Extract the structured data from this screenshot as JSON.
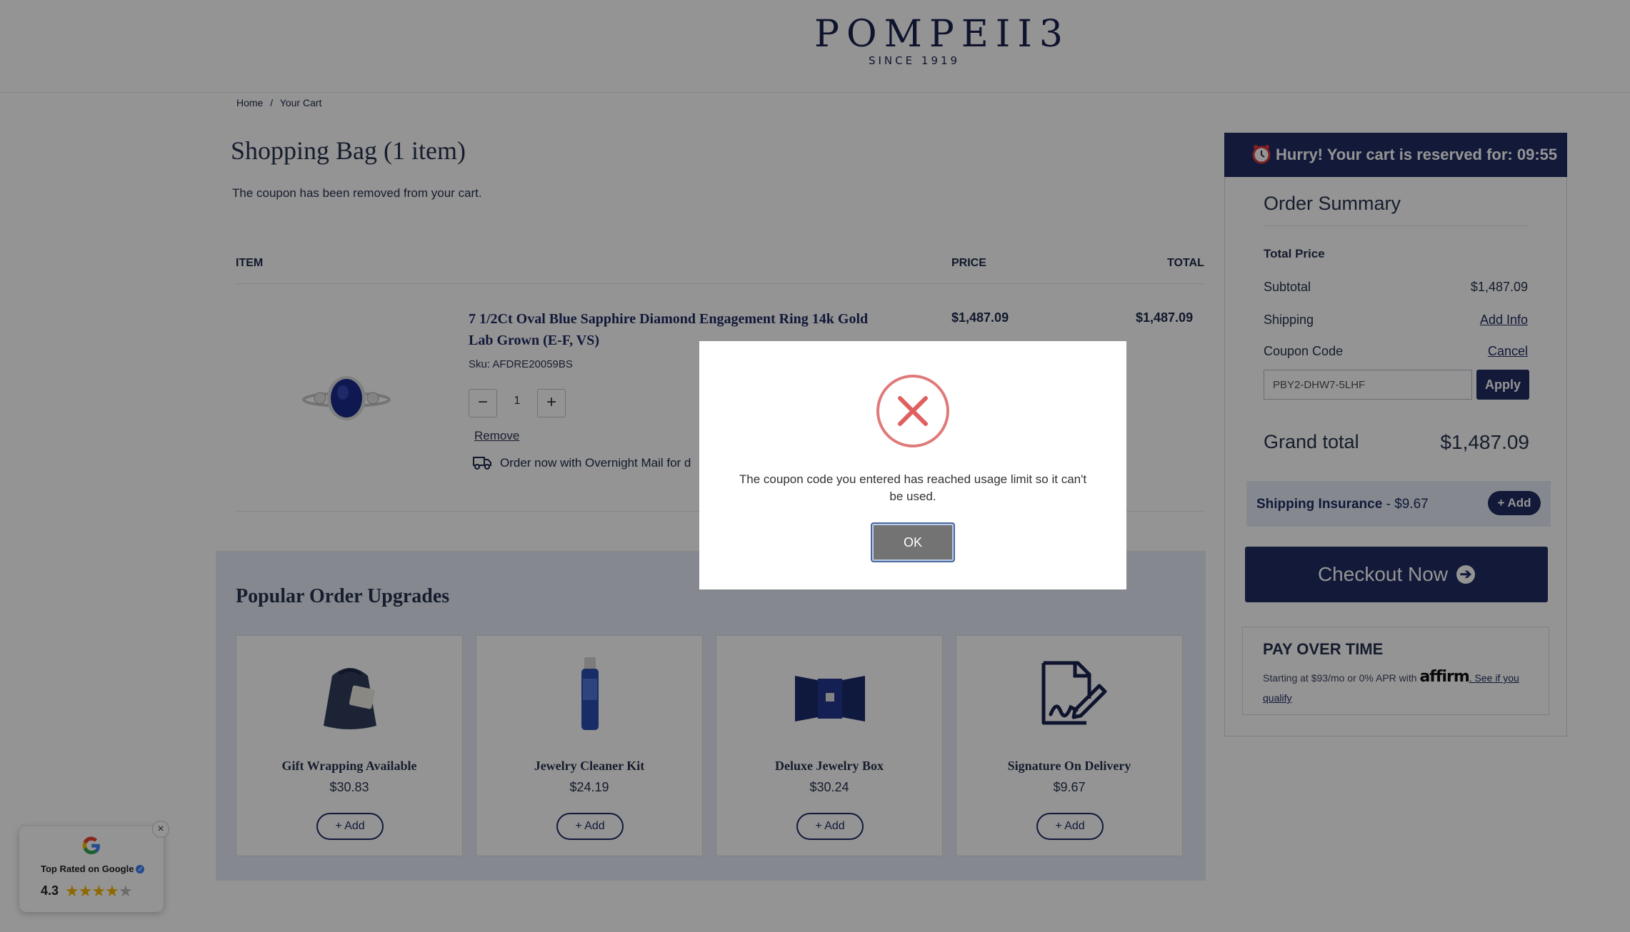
{
  "header": {
    "logo_main": "POMPEII3",
    "logo_sub": "SINCE 1919"
  },
  "breadcrumb": {
    "home": "Home",
    "separator": "/",
    "current": "Your Cart"
  },
  "cart": {
    "title": "Shopping Bag (1 item)",
    "notice": "The coupon has been removed from your cart.",
    "columns": {
      "item": "ITEM",
      "price": "PRICE",
      "total": "TOTAL"
    },
    "item": {
      "name": "7 1/2Ct Oval Blue Sapphire Diamond Engagement Ring 14k Gold Lab Grown (E-F, VS)",
      "sku": "Sku: AFDRE20059BS",
      "quantity": "1",
      "minus": "−",
      "plus": "+",
      "remove": "Remove",
      "shipping_note": "Order now with Overnight Mail for d",
      "price": "$1,487.09",
      "total": "$1,487.09"
    }
  },
  "upgrades": {
    "title": "Popular Order Upgrades",
    "add_label": "+ Add",
    "items": [
      {
        "name": "Gift Wrapping Available",
        "price": "$30.83",
        "icon": "gift-bag-icon"
      },
      {
        "name": "Jewelry Cleaner Kit",
        "price": "$24.19",
        "icon": "cleaner-bottle-icon"
      },
      {
        "name": "Deluxe Jewelry Box",
        "price": "$30.24",
        "icon": "jewelry-box-icon"
      },
      {
        "name": "Signature On Delivery",
        "price": "$9.67",
        "icon": "signature-icon"
      }
    ]
  },
  "sidebar": {
    "timer_text": "Hurry! Your cart is reserved for: 09:55",
    "summary_title": "Order Summary",
    "total_price_label": "Total Price",
    "subtotal_label": "Subtotal",
    "subtotal_value": "$1,487.09",
    "shipping_label": "Shipping",
    "shipping_link": "Add Info",
    "coupon_label": "Coupon Code",
    "coupon_cancel": "Cancel",
    "coupon_value": "PBY2-DHW7-5LHF",
    "apply_label": "Apply",
    "grand_total_label": "Grand total",
    "grand_total_value": "$1,487.09",
    "insurance_label": "Shipping Insurance",
    "insurance_price": " - $9.67",
    "insurance_add": "+ Add",
    "checkout_label": "Checkout Now",
    "pay_title": "PAY OVER TIME",
    "pay_text_1": "Starting at $93/mo or 0% APR with",
    "pay_brand": "affirm",
    "pay_text_2": ". See if you qualify"
  },
  "google_badge": {
    "label": "Top Rated on Google",
    "rating": "4.3",
    "stars": 4.3,
    "close": "×"
  },
  "modal": {
    "message": "The coupon code you entered has reached usage limit so it can't be used.",
    "ok_label": "OK",
    "icon": "error-x-icon"
  },
  "colors": {
    "brand_navy": "#1f2c63",
    "upgrade_bg": "#e6edf7",
    "error_red": "#e07a7a"
  }
}
